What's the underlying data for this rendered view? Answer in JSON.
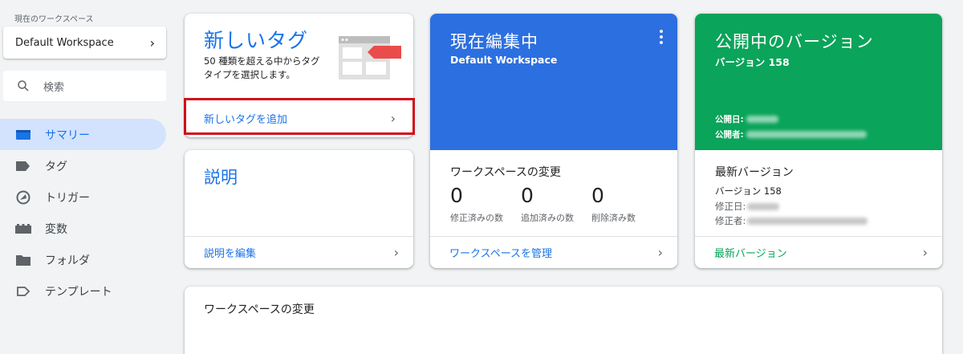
{
  "sidebar": {
    "workspace_label": "現在のワークスペース",
    "workspace_name": "Default Workspace",
    "search_placeholder": "検索",
    "items": [
      {
        "label": "サマリー",
        "icon": "summary-icon",
        "active": true
      },
      {
        "label": "タグ",
        "icon": "tag-icon"
      },
      {
        "label": "トリガー",
        "icon": "trigger-icon"
      },
      {
        "label": "変数",
        "icon": "variable-icon"
      },
      {
        "label": "フォルダ",
        "icon": "folder-icon"
      },
      {
        "label": "テンプレート",
        "icon": "template-icon"
      }
    ]
  },
  "new_tag": {
    "title": "新しいタグ",
    "description": "50 種類を超える中からタグタイプを選択します。",
    "link": "新しいタグを追加"
  },
  "description_card": {
    "title": "説明",
    "link": "説明を編集"
  },
  "editing": {
    "title": "現在編集中",
    "workspace": "Default Workspace",
    "changes_title": "ワークスペースの変更",
    "counts": [
      {
        "value": "0",
        "label": "修正済みの数"
      },
      {
        "value": "0",
        "label": "追加済みの数"
      },
      {
        "value": "0",
        "label": "削除済み数"
      }
    ],
    "link": "ワークスペースを管理"
  },
  "published": {
    "title": "公開中のバージョン",
    "version": "バージョン 158",
    "published_date_label": "公開日:",
    "published_by_label": "公開者:",
    "latest_title": "最新バージョン",
    "latest_version": "バージョン 158",
    "modified_date_label": "修正日:",
    "modified_by_label": "修正者:",
    "link": "最新バージョン"
  },
  "workspace_changes": {
    "title": "ワークスペースの変更"
  },
  "colors": {
    "accent": "#1a73e8",
    "editing_bg": "#2c6fe0",
    "published_bg": "#0aa45a",
    "highlight": "#d10f18"
  }
}
